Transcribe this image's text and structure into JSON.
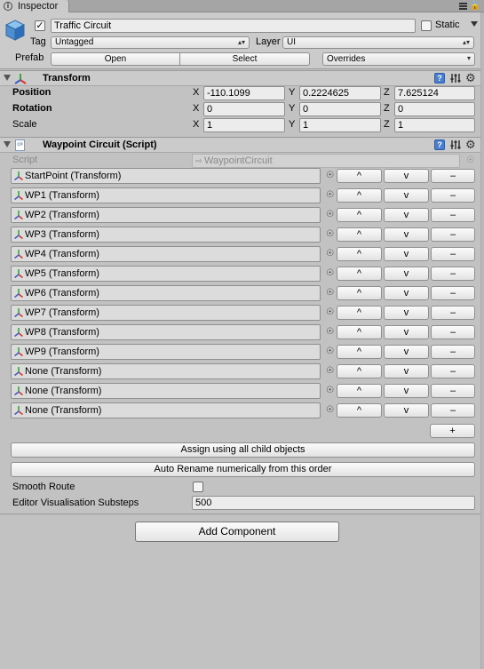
{
  "tab": {
    "title": "Inspector",
    "icon": "info-icon"
  },
  "header": {
    "active": true,
    "name": "Traffic Circuit",
    "static_label": "Static",
    "static_checked": false,
    "tag_label": "Tag",
    "tag_value": "Untagged",
    "layer_label": "Layer",
    "layer_value": "UI",
    "prefab_label": "Prefab",
    "prefab_open": "Open",
    "prefab_select": "Select",
    "prefab_overrides": "Overrides"
  },
  "transform": {
    "title": "Transform",
    "rows": [
      {
        "label": "Position",
        "x": "-110.1099",
        "y": "0.2224625",
        "z": "7.625124"
      },
      {
        "label": "Rotation",
        "x": "0",
        "y": "0",
        "z": "0"
      },
      {
        "label": "Scale",
        "x": "1",
        "y": "1",
        "z": "1"
      }
    ],
    "axis": {
      "x": "X",
      "y": "Y",
      "z": "Z"
    }
  },
  "waypoint": {
    "title": "Waypoint Circuit (Script)",
    "script_label": "Script",
    "script_value": "WaypointCircuit",
    "items": [
      "StartPoint (Transform)",
      "WP1 (Transform)",
      "WP2 (Transform)",
      "WP3 (Transform)",
      "WP4 (Transform)",
      "WP5 (Transform)",
      "WP6 (Transform)",
      "WP7 (Transform)",
      "WP8 (Transform)",
      "WP9 (Transform)",
      "None (Transform)",
      "None (Transform)",
      "None (Transform)"
    ],
    "up_label": "^",
    "down_label": "v",
    "remove_label": "–",
    "add_label": "+",
    "assign_label": "Assign using all child objects",
    "rename_label": "Auto Rename numerically from this order",
    "smooth_label": "Smooth Route",
    "smooth_checked": false,
    "substeps_label": "Editor Visualisation Substeps",
    "substeps_value": "500"
  },
  "add_component": "Add Component",
  "colors": {
    "window": "#c2c2c2",
    "header": "#cbcbcb",
    "help_blue": "#4a7fd0",
    "axis_red": "#d23a2a",
    "axis_green": "#3aa53a",
    "axis_blue": "#3a5fd2"
  }
}
